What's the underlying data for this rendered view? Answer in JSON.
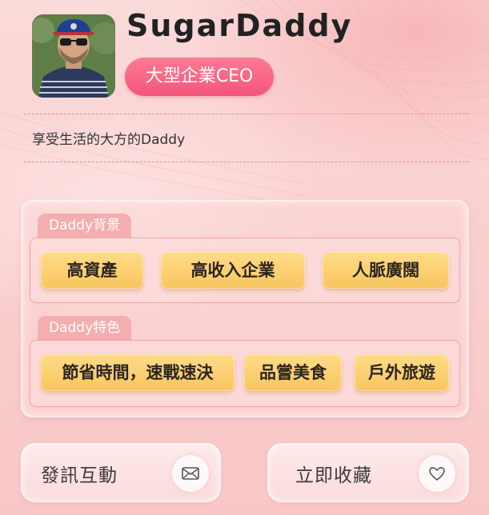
{
  "profile": {
    "username": "SugarDaddy",
    "title": "大型企業CEO",
    "bio": "享受生活的大方的Daddy"
  },
  "background_section": {
    "label": "Daddy背景",
    "tags": [
      "高資產",
      "高收入企業",
      "人脈廣闊"
    ]
  },
  "features_section": {
    "label": "Daddy特色",
    "tags": [
      "節省時間，速戰速決",
      "品嘗美食",
      "戶外旅遊"
    ]
  },
  "actions": {
    "message_label": "發訊互動",
    "message_icon": "mail-icon",
    "favorite_label": "立即收藏",
    "favorite_icon": "heart-icon"
  },
  "colors": {
    "accent_pink": "#f2557a",
    "tag_yellow": "#f8c55e",
    "section_label_pink": "#f4aeb0"
  }
}
